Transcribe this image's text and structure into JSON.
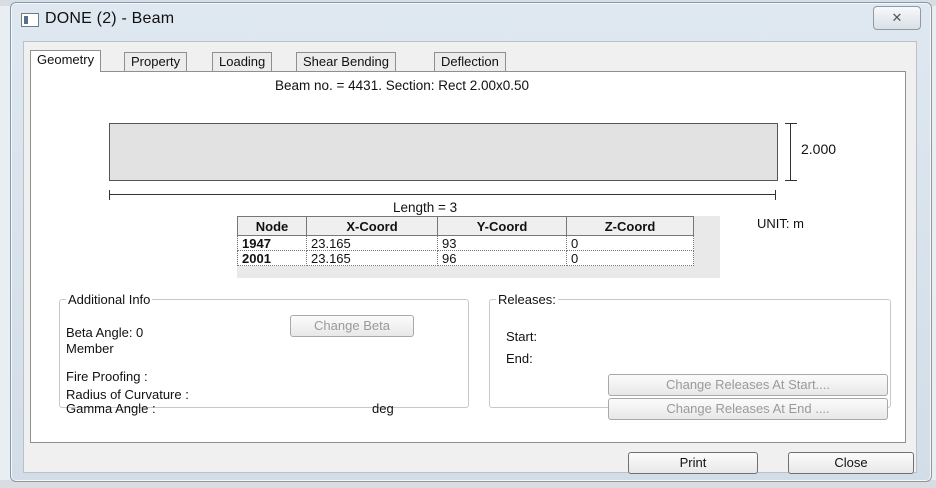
{
  "window": {
    "title": "DONE (2) - Beam",
    "close_glyph": "✕"
  },
  "tabs": [
    {
      "label": "Geometry",
      "active": true
    },
    {
      "label": "Property",
      "active": false
    },
    {
      "label": "Loading",
      "active": false
    },
    {
      "label": "Shear Bending",
      "active": false
    },
    {
      "label": "Deflection",
      "active": false
    }
  ],
  "geometry": {
    "caption": "Beam no. = 4431. Section: Rect 2.00x0.50",
    "height_label": "2.000",
    "length_label": "Length = 3",
    "unit_label": "UNIT: m",
    "table": {
      "headers": [
        "Node",
        "X-Coord",
        "Y-Coord",
        "Z-Coord"
      ],
      "rows": [
        [
          "1947",
          "23.165",
          "93",
          "0"
        ],
        [
          "2001",
          "23.165",
          "96",
          "0"
        ]
      ]
    }
  },
  "additional_info": {
    "legend": "Additional Info",
    "beta_angle_label": "Beta Angle:",
    "beta_angle_value": "0",
    "member_label": "Member",
    "change_beta_button": "Change Beta",
    "fire_proofing_label": "Fire Proofing :",
    "radius_label": "Radius of Curvature :",
    "gamma_label": "Gamma Angle :",
    "gamma_unit": "deg"
  },
  "releases": {
    "legend": "Releases:",
    "start_label": "Start:",
    "end_label": "End:",
    "change_start_button": "Change Releases At Start....",
    "change_end_button": "Change Releases At End ...."
  },
  "footer": {
    "print_button": "Print",
    "close_button": "Close"
  }
}
